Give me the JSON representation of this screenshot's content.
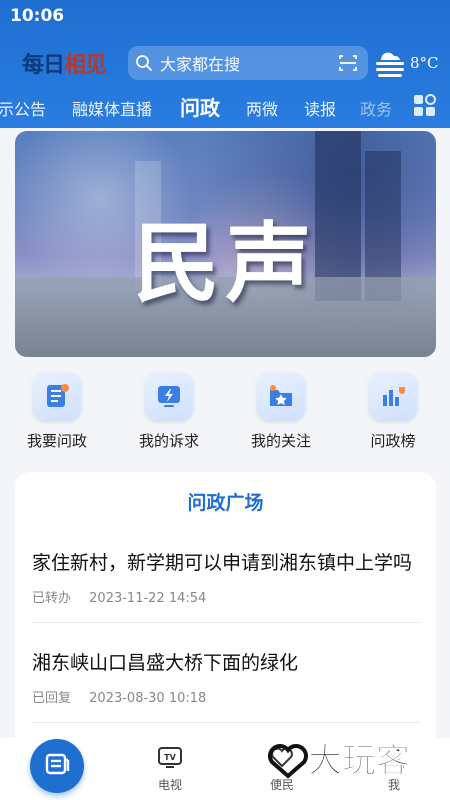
{
  "status_bar": {
    "time": "10:06"
  },
  "header": {
    "logo_part1": "每日",
    "logo_part2": "相见",
    "search_placeholder": "大家都在搜",
    "temperature": "8°C"
  },
  "tabs": [
    {
      "label": "示公告"
    },
    {
      "label": "融媒体直播"
    },
    {
      "label": "问政",
      "active": true
    },
    {
      "label": "两微"
    },
    {
      "label": "读报"
    },
    {
      "label": "政务"
    }
  ],
  "banner": {
    "title": "民声"
  },
  "quick_actions": [
    {
      "label": "我要问政",
      "icon": "document-icon"
    },
    {
      "label": "我的诉求",
      "icon": "lightning-icon"
    },
    {
      "label": "我的关注",
      "icon": "star-folder-icon"
    },
    {
      "label": "问政榜",
      "icon": "trophy-chart-icon"
    }
  ],
  "plaza": {
    "title": "问政广场",
    "items": [
      {
        "title": "家住新村，新学期可以申请到湘东镇中上学吗",
        "status": "已转办",
        "time": "2023-11-22 14:54"
      },
      {
        "title": "湘东峡山口昌盛大桥下面的绿化",
        "status": "已回复",
        "time": "2023-08-30 10:18"
      }
    ]
  },
  "bottom_nav": [
    {
      "label": "",
      "icon": "news-icon"
    },
    {
      "label": "电视",
      "icon": "tv-icon"
    },
    {
      "label": "便民",
      "icon": "heart-hand-icon"
    },
    {
      "label": "我",
      "icon": "user-icon"
    }
  ],
  "watermark": {
    "text": "大玩客"
  },
  "colors": {
    "primary": "#1f6fd1",
    "header": "#2a7ce0",
    "accent_red": "#b23a2e"
  }
}
